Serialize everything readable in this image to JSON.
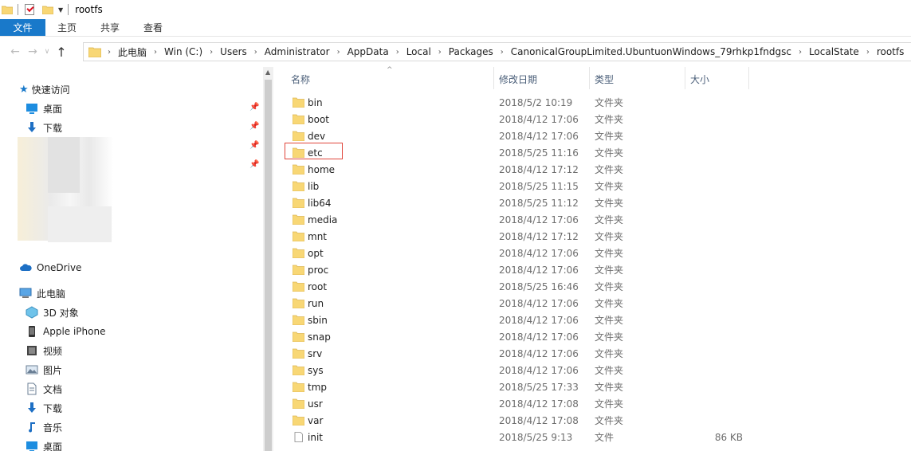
{
  "window": {
    "title": "rootfs"
  },
  "ribbon": {
    "tabs": [
      "文件",
      "主页",
      "共享",
      "查看"
    ]
  },
  "address": {
    "crumbs": [
      "此电脑",
      "Win (C:)",
      "Users",
      "Administrator",
      "AppData",
      "Local",
      "Packages",
      "CanonicalGroupLimited.UbuntuonWindows_79rhkp1fndgsc",
      "LocalState",
      "rootfs"
    ]
  },
  "sidebar": {
    "quick_access": "快速访问",
    "pinned": [
      {
        "label": "桌面",
        "icon": "desktop-icon"
      },
      {
        "label": "下载",
        "icon": "download-icon"
      }
    ],
    "onedrive": "OneDrive",
    "this_pc": "此电脑",
    "pc_items": [
      {
        "label": "3D 对象",
        "icon": "3d-objects-icon"
      },
      {
        "label": "Apple iPhone",
        "icon": "phone-icon"
      },
      {
        "label": "视频",
        "icon": "video-icon"
      },
      {
        "label": "图片",
        "icon": "pictures-icon"
      },
      {
        "label": "文档",
        "icon": "documents-icon"
      },
      {
        "label": "下载",
        "icon": "download-icon"
      },
      {
        "label": "音乐",
        "icon": "music-icon"
      },
      {
        "label": "桌面",
        "icon": "desktop-icon"
      }
    ]
  },
  "columns": {
    "name": "名称",
    "date": "修改日期",
    "type": "类型",
    "size": "大小"
  },
  "files": [
    {
      "name": "bin",
      "date": "2018/5/2 10:19",
      "type": "文件夹",
      "size": "",
      "kind": "folder"
    },
    {
      "name": "boot",
      "date": "2018/4/12 17:06",
      "type": "文件夹",
      "size": "",
      "kind": "folder"
    },
    {
      "name": "dev",
      "date": "2018/4/12 17:06",
      "type": "文件夹",
      "size": "",
      "kind": "folder"
    },
    {
      "name": "etc",
      "date": "2018/5/25 11:16",
      "type": "文件夹",
      "size": "",
      "kind": "folder",
      "highlighted": true
    },
    {
      "name": "home",
      "date": "2018/4/12 17:12",
      "type": "文件夹",
      "size": "",
      "kind": "folder"
    },
    {
      "name": "lib",
      "date": "2018/5/25 11:15",
      "type": "文件夹",
      "size": "",
      "kind": "folder"
    },
    {
      "name": "lib64",
      "date": "2018/5/25 11:12",
      "type": "文件夹",
      "size": "",
      "kind": "folder"
    },
    {
      "name": "media",
      "date": "2018/4/12 17:06",
      "type": "文件夹",
      "size": "",
      "kind": "folder"
    },
    {
      "name": "mnt",
      "date": "2018/4/12 17:12",
      "type": "文件夹",
      "size": "",
      "kind": "folder"
    },
    {
      "name": "opt",
      "date": "2018/4/12 17:06",
      "type": "文件夹",
      "size": "",
      "kind": "folder"
    },
    {
      "name": "proc",
      "date": "2018/4/12 17:06",
      "type": "文件夹",
      "size": "",
      "kind": "folder"
    },
    {
      "name": "root",
      "date": "2018/5/25 16:46",
      "type": "文件夹",
      "size": "",
      "kind": "folder"
    },
    {
      "name": "run",
      "date": "2018/4/12 17:06",
      "type": "文件夹",
      "size": "",
      "kind": "folder"
    },
    {
      "name": "sbin",
      "date": "2018/4/12 17:06",
      "type": "文件夹",
      "size": "",
      "kind": "folder"
    },
    {
      "name": "snap",
      "date": "2018/4/12 17:06",
      "type": "文件夹",
      "size": "",
      "kind": "folder"
    },
    {
      "name": "srv",
      "date": "2018/4/12 17:06",
      "type": "文件夹",
      "size": "",
      "kind": "folder"
    },
    {
      "name": "sys",
      "date": "2018/4/12 17:06",
      "type": "文件夹",
      "size": "",
      "kind": "folder"
    },
    {
      "name": "tmp",
      "date": "2018/5/25 17:33",
      "type": "文件夹",
      "size": "",
      "kind": "folder"
    },
    {
      "name": "usr",
      "date": "2018/4/12 17:08",
      "type": "文件夹",
      "size": "",
      "kind": "folder"
    },
    {
      "name": "var",
      "date": "2018/4/12 17:08",
      "type": "文件夹",
      "size": "",
      "kind": "folder"
    },
    {
      "name": "init",
      "date": "2018/5/25 9:13",
      "type": "文件",
      "size": "86 KB",
      "kind": "file"
    }
  ],
  "colors": {
    "accent": "#1979ca",
    "folder": "#f8d775",
    "highlight": "#e0463b",
    "header_text": "#4c607a"
  }
}
